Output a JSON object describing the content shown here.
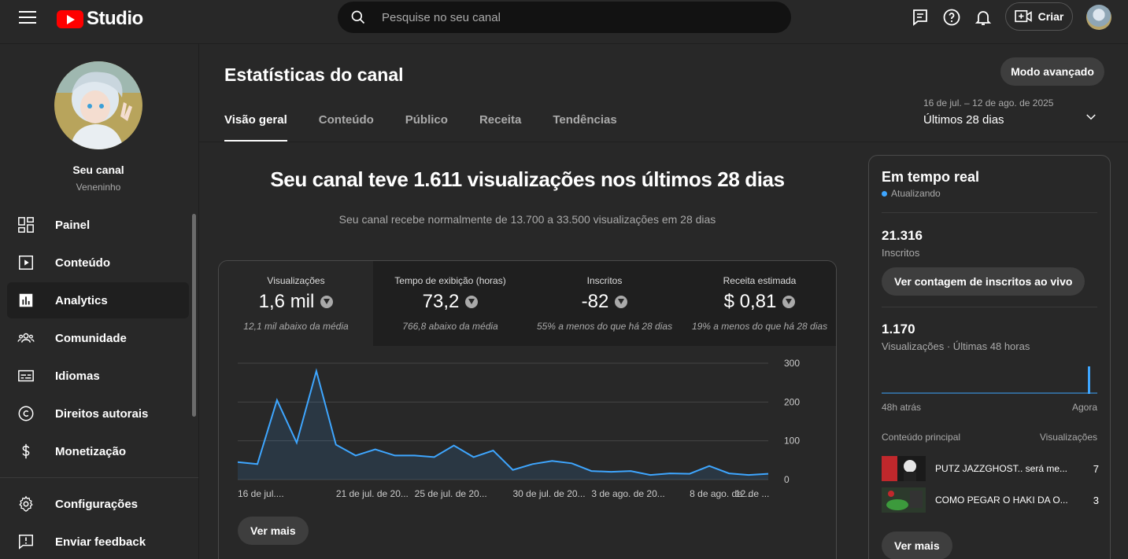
{
  "topbar": {
    "logo_text": "Studio",
    "search_placeholder": "Pesquise no seu canal",
    "create_label": "Criar"
  },
  "sidebar": {
    "channel_title": "Seu canal",
    "channel_name": "Veneninho",
    "items": [
      {
        "label": "Painel",
        "icon": "dashboard-icon"
      },
      {
        "label": "Conteúdo",
        "icon": "content-icon"
      },
      {
        "label": "Analytics",
        "icon": "analytics-icon",
        "active": true
      },
      {
        "label": "Comunidade",
        "icon": "community-icon"
      },
      {
        "label": "Idiomas",
        "icon": "subtitles-icon"
      },
      {
        "label": "Direitos autorais",
        "icon": "copyright-icon"
      },
      {
        "label": "Monetização",
        "icon": "dollar-icon"
      }
    ],
    "bottom_items": [
      {
        "label": "Configurações",
        "icon": "gear-icon"
      },
      {
        "label": "Enviar feedback",
        "icon": "feedback-icon"
      }
    ]
  },
  "main": {
    "title": "Estatísticas do canal",
    "advanced_button": "Modo avançado",
    "tabs": [
      "Visão geral",
      "Conteúdo",
      "Público",
      "Receita",
      "Tendências"
    ],
    "date_range": "16 de jul. – 12 de ago. de 2025",
    "period": "Últimos 28 dias",
    "headline": "Seu canal teve 1.611 visualizações nos últimos 28 dias",
    "subheadline": "Seu canal recebe normalmente de 13.700 a 33.500 visualizações em 28 dias",
    "metrics": [
      {
        "label": "Visualizações",
        "value": "1,6 mil",
        "note": "12,1 mil abaixo da média"
      },
      {
        "label": "Tempo de exibição (horas)",
        "value": "73,2",
        "note": "766,8 abaixo da média"
      },
      {
        "label": "Inscritos",
        "value": "-82",
        "note": "55% a menos do que há 28 dias"
      },
      {
        "label": "Receita estimada",
        "value": "$ 0,81",
        "note": "19% a menos do que há 28 dias"
      }
    ],
    "see_more": "Ver mais"
  },
  "chart_data": {
    "type": "area",
    "x_tick_labels": [
      "16 de jul....",
      "21 de jul. de 20...",
      "25 de jul. de 20...",
      "30 de jul. de 20...",
      "3 de ago. de 20...",
      "8 de ago. de ...",
      "12 de ..."
    ],
    "y_ticks": [
      0,
      100,
      200,
      300
    ],
    "ylim": [
      0,
      300
    ],
    "values": [
      45,
      40,
      205,
      95,
      280,
      90,
      62,
      78,
      62,
      62,
      58,
      88,
      58,
      75,
      25,
      40,
      48,
      42,
      22,
      20,
      22,
      12,
      16,
      15,
      35,
      16,
      12,
      15
    ],
    "color": "#3ea6ff"
  },
  "realtime": {
    "title": "Em tempo real",
    "status": "Atualizando",
    "subscribers_value": "21.316",
    "subscribers_label": "Inscritos",
    "live_count_button": "Ver contagem de inscritos ao vivo",
    "views_value": "1.170",
    "views_label": "Visualizações · Últimas 48 horas",
    "axis_left": "48h atrás",
    "axis_right": "Agora",
    "top_content_label": "Conteúdo principal",
    "views_col_label": "Visualizações",
    "videos": [
      {
        "title": "PUTZ JAZZGHOST.. será me...",
        "views": "7"
      },
      {
        "title": "COMO PEGAR O HAKI DA O...",
        "views": "3"
      }
    ],
    "see_more": "Ver mais"
  }
}
